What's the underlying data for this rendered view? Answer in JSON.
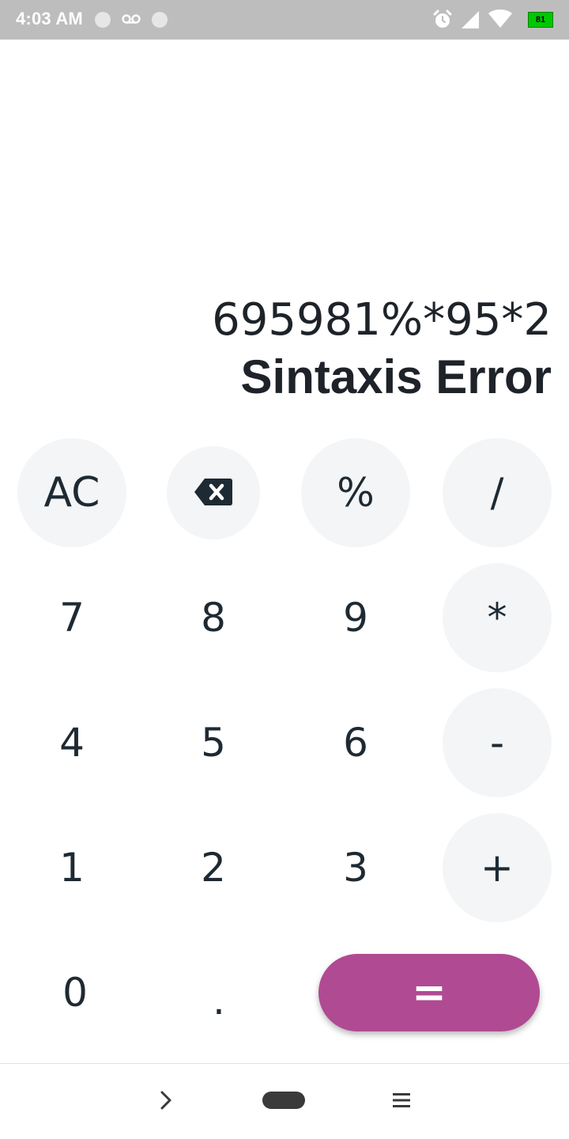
{
  "status_bar": {
    "time": "4:03 AM",
    "battery_level": "81",
    "icons": [
      "notification-dot-icon",
      "voicemail-icon",
      "notification-dot-icon",
      "alarm-icon",
      "cell-signal-icon",
      "wifi-icon",
      "battery-icon"
    ]
  },
  "display": {
    "expression": "695981%*95*2",
    "result": "Sintaxis Error"
  },
  "keypad": {
    "ac": "AC",
    "backspace_icon": "backspace-icon",
    "percent": "%",
    "divide": "/",
    "seven": "7",
    "eight": "8",
    "nine": "9",
    "multiply": "*",
    "four": "4",
    "five": "5",
    "six": "6",
    "minus": "-",
    "one": "1",
    "two": "2",
    "three": "3",
    "plus": "+",
    "zero": "0",
    "dot": ".",
    "equals": "="
  },
  "nav_bar": {
    "icons": [
      "back-chevron-icon",
      "home-pill-icon",
      "menu-icon"
    ]
  },
  "colors": {
    "accent": "#b04a93",
    "key_bg": "#f3f5f7",
    "text": "#1e2a33",
    "status_bar": "#bdbdbd",
    "battery": "#00c800"
  }
}
